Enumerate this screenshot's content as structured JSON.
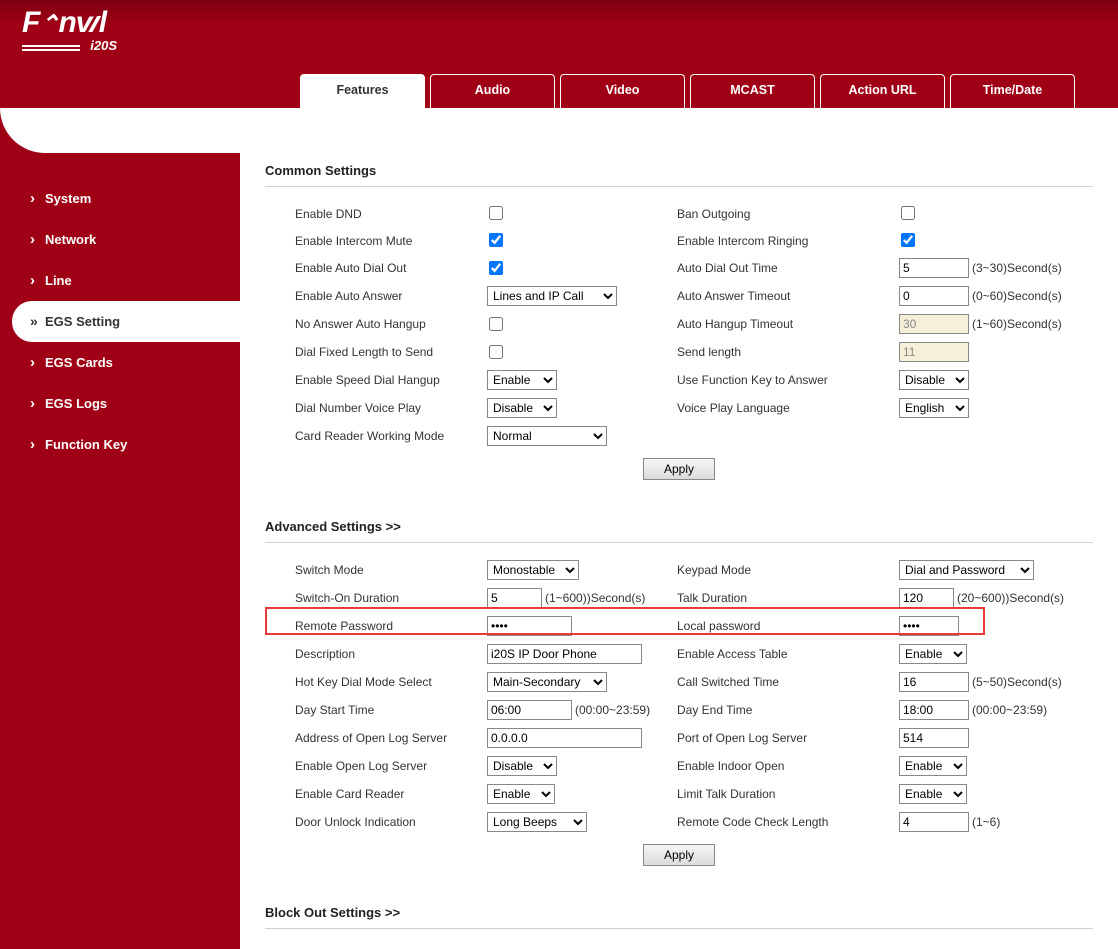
{
  "brand": {
    "name": "Fanvil",
    "model": "i20S"
  },
  "nav": {
    "items": [
      {
        "label": "System"
      },
      {
        "label": "Network"
      },
      {
        "label": "Line"
      },
      {
        "label": "EGS Setting",
        "active": true
      },
      {
        "label": "EGS Cards"
      },
      {
        "label": "EGS Logs"
      },
      {
        "label": "Function Key"
      }
    ]
  },
  "tabs": [
    {
      "label": "Features",
      "active": true
    },
    {
      "label": "Audio"
    },
    {
      "label": "Video"
    },
    {
      "label": "MCAST"
    },
    {
      "label": "Action URL"
    },
    {
      "label": "Time/Date"
    }
  ],
  "section_common_title": "Common Settings",
  "section_advanced_title": "Advanced Settings >>",
  "section_block_title": "Block Out Settings >>",
  "apply_label": "Apply",
  "common": {
    "enable_dnd_label": "Enable DND",
    "enable_dnd": false,
    "ban_outgoing_label": "Ban Outgoing",
    "ban_outgoing": false,
    "enable_intercom_mute_label": "Enable Intercom Mute",
    "enable_intercom_mute": true,
    "enable_intercom_ringing_label": "Enable Intercom Ringing",
    "enable_intercom_ringing": true,
    "enable_auto_dial_out_label": "Enable Auto Dial Out",
    "enable_auto_dial_out": true,
    "auto_dial_out_time_label": "Auto Dial Out Time",
    "auto_dial_out_time": "5",
    "auto_dial_out_time_hint": "(3~30)Second(s)",
    "enable_auto_answer_label": "Enable Auto Answer",
    "enable_auto_answer": "Lines and IP Call",
    "auto_answer_timeout_label": "Auto Answer Timeout",
    "auto_answer_timeout": "0",
    "auto_answer_timeout_hint": "(0~60)Second(s)",
    "no_answer_auto_hangup_label": "No Answer Auto Hangup",
    "no_answer_auto_hangup": false,
    "auto_hangup_timeout_label": "Auto Hangup Timeout",
    "auto_hangup_timeout": "30",
    "auto_hangup_timeout_hint": "(1~60)Second(s)",
    "dial_fixed_length_label": "Dial Fixed Length to Send",
    "dial_fixed_length": false,
    "send_length_label": "Send length",
    "send_length": "11",
    "enable_speed_dial_hangup_label": "Enable Speed Dial Hangup",
    "enable_speed_dial_hangup": "Enable",
    "use_function_key_label": "Use Function Key to Answer",
    "use_function_key": "Disable",
    "dial_number_voice_play_label": "Dial Number Voice Play",
    "dial_number_voice_play": "Disable",
    "voice_play_language_label": "Voice Play Language",
    "voice_play_language": "English",
    "card_reader_mode_label": "Card Reader Working Mode",
    "card_reader_mode": "Normal"
  },
  "advanced": {
    "switch_mode_label": "Switch Mode",
    "switch_mode": "Monostable",
    "keypad_mode_label": "Keypad Mode",
    "keypad_mode": "Dial and Password",
    "switch_on_duration_label": "Switch-On Duration",
    "switch_on_duration": "5",
    "switch_on_duration_hint": "(1~600))Second(s)",
    "talk_duration_label": "Talk Duration",
    "talk_duration": "120",
    "talk_duration_hint": "(20~600))Second(s)",
    "remote_password_label": "Remote Password",
    "remote_password": "••••",
    "local_password_label": "Local password",
    "local_password": "••••",
    "description_label": "Description",
    "description": "i20S IP Door Phone",
    "enable_access_table_label": "Enable Access Table",
    "enable_access_table": "Enable",
    "hot_key_dial_mode_label": "Hot Key Dial Mode Select",
    "hot_key_dial_mode": "Main-Secondary",
    "call_switched_time_label": "Call Switched Time",
    "call_switched_time": "16",
    "call_switched_time_hint": "(5~50)Second(s)",
    "day_start_time_label": "Day Start Time",
    "day_start_time": "06:00",
    "day_start_time_hint": "(00:00~23:59)",
    "day_end_time_label": "Day End Time",
    "day_end_time": "18:00",
    "day_end_time_hint": "(00:00~23:59)",
    "address_open_log_label": "Address of Open Log Server",
    "address_open_log": "0.0.0.0",
    "port_open_log_label": "Port of Open Log Server",
    "port_open_log": "514",
    "enable_open_log_server_label": "Enable Open Log Server",
    "enable_open_log_server": "Disable",
    "enable_indoor_open_label": "Enable Indoor Open",
    "enable_indoor_open": "Enable",
    "enable_card_reader_label": "Enable Card Reader",
    "enable_card_reader": "Enable",
    "limit_talk_duration_label": "Limit Talk Duration",
    "limit_talk_duration": "Enable",
    "door_unlock_indication_label": "Door Unlock Indication",
    "door_unlock_indication": "Long Beeps",
    "remote_code_check_length_label": "Remote Code Check Length",
    "remote_code_check_length": "4",
    "remote_code_check_length_hint": "(1~6)"
  }
}
